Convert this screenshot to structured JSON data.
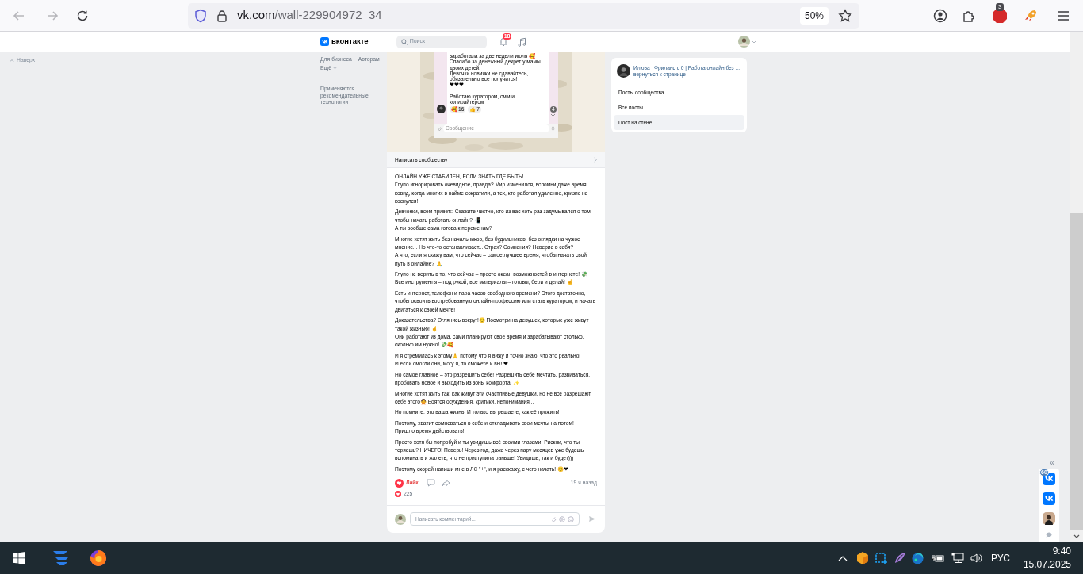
{
  "browser": {
    "url_host": "vk.com",
    "url_path": "/wall-229904972_34",
    "zoom": "50%",
    "extension_badge": "3"
  },
  "header": {
    "logo": "вконтакте",
    "search_placeholder": "Поиск",
    "notifications": "18"
  },
  "back_to_top": "Наверх",
  "left_links": [
    {
      "label": "Для бизнеса",
      "has_caret": false
    },
    {
      "label": "Авторам",
      "has_caret": false
    },
    {
      "label": "Ещё",
      "has_caret": true
    }
  ],
  "recommendation_note": "Применяются рекомендательные технологии",
  "post": {
    "chat_screenshot": {
      "message": "заработала за две недели июля 🥰\nСпасибо за денежный декрет у мамы двоих детей.\nДевочки новички не сдавайтесь, обязательно все получится!\n❤❤❤\n\nРаботаю куратором, смм и копирайтером",
      "reactions": [
        {
          "emoji": "🥰",
          "count": "16"
        },
        {
          "emoji": "👍",
          "count": "7"
        }
      ],
      "scroll_badge": "4",
      "input_placeholder": "Сообщение"
    },
    "write_community": "Написать сообществу",
    "paragraphs": [
      "ОНЛАЙН УЖЕ СТАБИЛЕН, ЕСЛИ ЗНАТЬ ГДЕ БЫТЬ!\nГлупо игнорировать очевидное, правда? Мир изменился, вспомни даже время ковид, когда многих в найме сократили, а тех, кто работал удаленно, кризис не коснулся!",
      "Девчонки, всем привет□ Скажите честно, кто из вас хоть раз задумывался о том, чтобы начать работать онлайн? 📲\nА ты вообще сама готова к переменам?",
      "Многие хотят жить без начальников, без будильников, без оглядки на чужое мнение... Но что-то останавливает... Страх? Сомнения? Неверие в себя?\nА что, если я скажу вам, что сейчас – самое лучшее время, чтобы начать свой путь в онлайне? 🙏",
      "Глупо не верить в то, что сейчас – просто океан возможностей в интернете! 💸\nВсе инструменты – под рукой, все материалы – готовы, бери и делай! ☝",
      "Есть интернет, телефон и пара часов свободного времени? Этого достаточно, чтобы освоить востребованную онлайн-профессию или стать куратором, и начать двигаться к своей мечте!",
      "Доказательства? Оглянись вокруг!😊 Посмотри на девушек, которые уже живут такой жизнью! ☝\nОни работают из дома, сами планируют своё время и зарабатывают столько, сколько им нужно! 💸🥰",
      "И я стремилась к этому🙏 потому что я вижу и точно знаю, что это реально!\nИ если смогли они, могу я, то сможете и вы! ❤",
      "Но самое главное – это разрешить себе! Разрешить себе мечтать, развиваться, пробовать новое и выходить из зоны комфорта! ✨",
      "Многие хотят жить так, как живут эти счастливые девушки, но не все разрешают себе этого🙅 Боятся осуждения, критики, непонимания...",
      "Но помните: это ваша жизнь! И только вы решаете, как её прожить!",
      "Поэтому, хватит сомневаться в себе и откладывать свои мечты на потом!\nПришло время действовать!",
      "Просто хотя бы попробуй и ты увидишь всё своими глазами! Рискни, что ты теряешь? НИЧЕГО! Поверь! Через год, даже через пару месяцев уже будешь вспоминать и жалеть, что не приступила раньше! Увидишь, так и будет)))",
      "Поэтому скорей напиши мне в ЛС \"+\", и я расскажу, с чего начать! 😊❤"
    ],
    "like": {
      "label": "Лайк",
      "liked": true
    },
    "time": "19 ч назад",
    "likes_count": "225",
    "comment_placeholder": "Написать комментарий..."
  },
  "side_panel": {
    "community": "Илюва | Фриланс с 0 | Работа онлайн без ...",
    "back_link": "вернуться к странице",
    "items": [
      {
        "label": "Посты сообщества",
        "selected": false
      },
      {
        "label": "Все посты",
        "selected": false
      },
      {
        "label": "Пост на стене",
        "selected": true
      }
    ]
  },
  "dock": {
    "collapse": "«",
    "badge": "60"
  },
  "taskbar": {
    "language": "РУС",
    "time": "9:40",
    "date": "15.07.2025"
  }
}
